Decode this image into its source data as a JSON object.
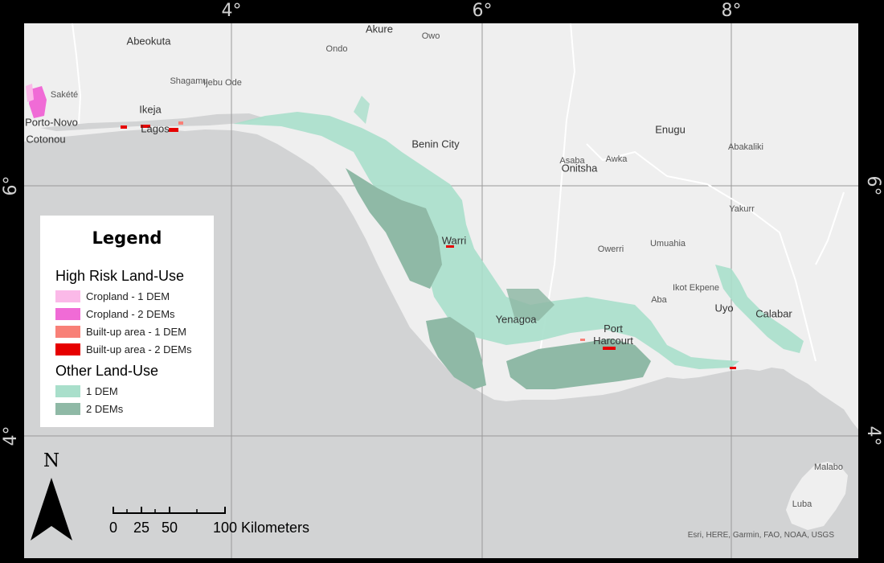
{
  "map": {
    "lon_labels": [
      "4°",
      "6°",
      "8°"
    ],
    "lat_labels": [
      "6°",
      "4°"
    ],
    "colors": {
      "sea": "#d2d3d4",
      "land": "#efefef",
      "river": "#ffffff",
      "graticule": "#9a9a9a",
      "other_1dem": "#a9dfcb",
      "other_2dem": "#8fb9a6"
    },
    "cities": [
      {
        "name": "Abeokuta",
        "size": "big"
      },
      {
        "name": "Akure",
        "size": "big"
      },
      {
        "name": "Owo",
        "size": "small"
      },
      {
        "name": "Ondo",
        "size": "small"
      },
      {
        "name": "Sakété",
        "size": "small"
      },
      {
        "name": "Shagamu",
        "size": "small"
      },
      {
        "name": "Ijebu Ode",
        "size": "small"
      },
      {
        "name": "Ikeja",
        "size": "big"
      },
      {
        "name": "Porto-Novo",
        "size": "big"
      },
      {
        "name": "Lagos",
        "size": "big"
      },
      {
        "name": "Cotonou",
        "size": "big"
      },
      {
        "name": "Benin City",
        "size": "big"
      },
      {
        "name": "Enugu",
        "size": "big"
      },
      {
        "name": "Abakaliki",
        "size": "small"
      },
      {
        "name": "Asaba",
        "size": "small"
      },
      {
        "name": "Awka",
        "size": "small"
      },
      {
        "name": "Onitsha",
        "size": "big"
      },
      {
        "name": "Yakurr",
        "size": "small"
      },
      {
        "name": "Warri",
        "size": "big"
      },
      {
        "name": "Umuahia",
        "size": "small"
      },
      {
        "name": "Owerri",
        "size": "small"
      },
      {
        "name": "Ikot Ekpene",
        "size": "small"
      },
      {
        "name": "Aba",
        "size": "small"
      },
      {
        "name": "Uyo",
        "size": "big"
      },
      {
        "name": "Calabar",
        "size": "big"
      },
      {
        "name": "Yenagoa",
        "size": "big"
      },
      {
        "name": "Port Harcourt",
        "size": "big"
      },
      {
        "name": "Malabo",
        "size": "small"
      },
      {
        "name": "Luba",
        "size": "small"
      }
    ]
  },
  "legend": {
    "title": "Legend",
    "groups": [
      {
        "title": "High Risk Land-Use",
        "items": [
          {
            "label": "Cropland - 1 DEM",
            "color": "#fbb9e8"
          },
          {
            "label": "Cropland - 2 DEMs",
            "color": "#f06bd6"
          },
          {
            "label": "Built-up area - 1 DEM",
            "color": "#f88077"
          },
          {
            "label": "Built-up area - 2 DEMs",
            "color": "#e60000"
          }
        ]
      },
      {
        "title": "Other Land-Use",
        "items": [
          {
            "label": "1 DEM",
            "color": "#a9dfcb"
          },
          {
            "label": "2 DEMs",
            "color": "#8fb9a6"
          }
        ]
      }
    ]
  },
  "north_arrow": {
    "label": "N"
  },
  "scale_bar": {
    "ticks": [
      "0",
      "25",
      "50",
      "100"
    ],
    "unit": "Kilometers"
  },
  "attribution": "Esri, HERE, Garmin, FAO, NOAA, USGS"
}
